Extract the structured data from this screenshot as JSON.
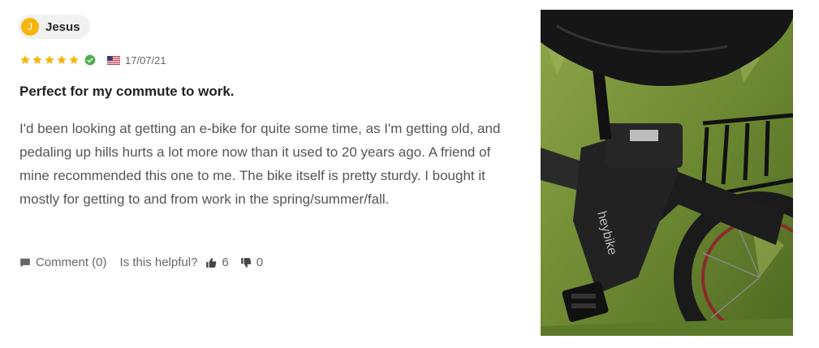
{
  "review": {
    "author": {
      "initial": "J",
      "name": "Jesus"
    },
    "rating": 5,
    "verified": true,
    "country_flag": "us-flag",
    "date": "17/07/21",
    "title": "Perfect for my commute to work.",
    "body": "I'd been looking at getting an e-bike for quite some time, as I'm getting old, and pedaling up hills hurts a lot more now than it used to 20 years ago. A friend of mine recommended this one to me. The bike itself is pretty sturdy. I bought it mostly for getting to and from work in the spring/summer/fall.",
    "actions": {
      "comment_label": "Comment (0)",
      "helpful_label": "Is this helpful?",
      "upvotes": "6",
      "downvotes": "0"
    },
    "photo_caption": "heybike"
  },
  "colors": {
    "star": "#f5b50a",
    "verified": "#4caf50",
    "avatar": "#f5b50a",
    "text": "#555555"
  },
  "icons": [
    "star-icon",
    "verified-check-icon",
    "us-flag-icon",
    "comment-icon",
    "thumbs-up-icon",
    "thumbs-down-icon"
  ]
}
